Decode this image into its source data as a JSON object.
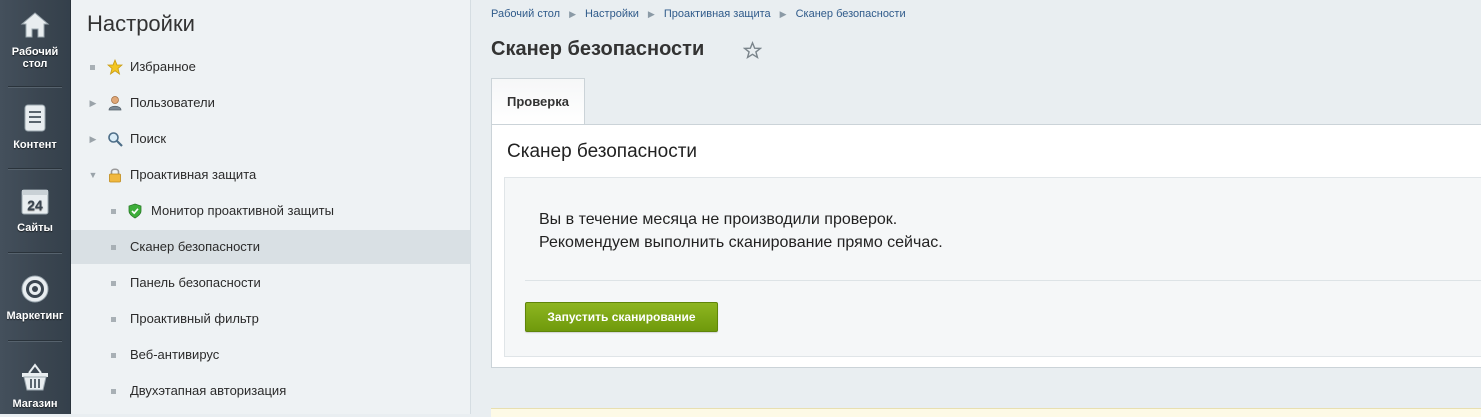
{
  "rail": {
    "items": [
      {
        "label_line1": "Рабочий",
        "label_line2": "стол",
        "icon": "home-icon"
      },
      {
        "label_line1": "Контент",
        "label_line2": "",
        "icon": "document-icon"
      },
      {
        "label_line1": "Сайты",
        "label_line2": "",
        "icon": "calendar-24-icon"
      },
      {
        "label_line1": "Маркетинг",
        "label_line2": "",
        "icon": "target-icon"
      },
      {
        "label_line1": "Магазин",
        "label_line2": "",
        "icon": "basket-icon"
      }
    ],
    "sites_badge": "24"
  },
  "menu": {
    "title": "Настройки",
    "items": [
      {
        "label": "Избранное",
        "icon": "star-icon"
      },
      {
        "label": "Пользователи",
        "icon": "user-icon"
      },
      {
        "label": "Поиск",
        "icon": "magnifier-icon"
      },
      {
        "label": "Проактивная защита",
        "icon": "lock-icon"
      },
      {
        "label": "Монитор проактивной защиты",
        "icon": "shield-icon"
      },
      {
        "label": "Сканер безопасности"
      },
      {
        "label": "Панель безопасности"
      },
      {
        "label": "Проактивный фильтр"
      },
      {
        "label": "Веб-антивирус"
      },
      {
        "label": "Двухэтапная авторизация"
      }
    ]
  },
  "breadcrumb": [
    "Рабочий стол",
    "Настройки",
    "Проактивная защита",
    "Сканер безопасности"
  ],
  "page": {
    "title": "Сканер безопасности",
    "tab_label": "Проверка",
    "panel_title": "Сканер безопасности",
    "message_line1": "Вы в течение месяца не производили проверок.",
    "message_line2": "Рекомендуем выполнить сканирование прямо сейчас.",
    "scan_button": "Запустить сканирование"
  },
  "colors": {
    "accent_green": "#7ba514",
    "link_blue": "#2f5a8a",
    "rail_dark": "#3a4550"
  }
}
